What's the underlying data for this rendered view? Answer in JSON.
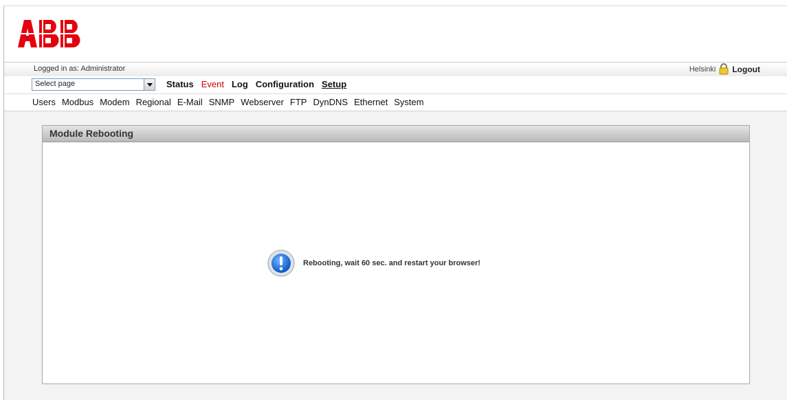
{
  "brand": {
    "logo_text": "ABB",
    "color": "#e4000f"
  },
  "infobar": {
    "logged_in": "Logged in as: Administrator",
    "city": "Helsinki",
    "logout": "Logout"
  },
  "nav": {
    "select_value": "Select page",
    "items": [
      "Status",
      "Event",
      "Log",
      "Configuration",
      "Setup"
    ],
    "active": "Setup",
    "highlight_color": "#d40000"
  },
  "subnav": {
    "items": [
      "Users",
      "Modbus",
      "Modem",
      "Regional",
      "E-Mail",
      "SNMP",
      "Webserver",
      "FTP",
      "DynDNS",
      "Ethernet",
      "System"
    ]
  },
  "panel": {
    "title": "Module Rebooting",
    "message": "Rebooting, wait 60 sec. and restart your browser!",
    "icon": "info-icon"
  }
}
